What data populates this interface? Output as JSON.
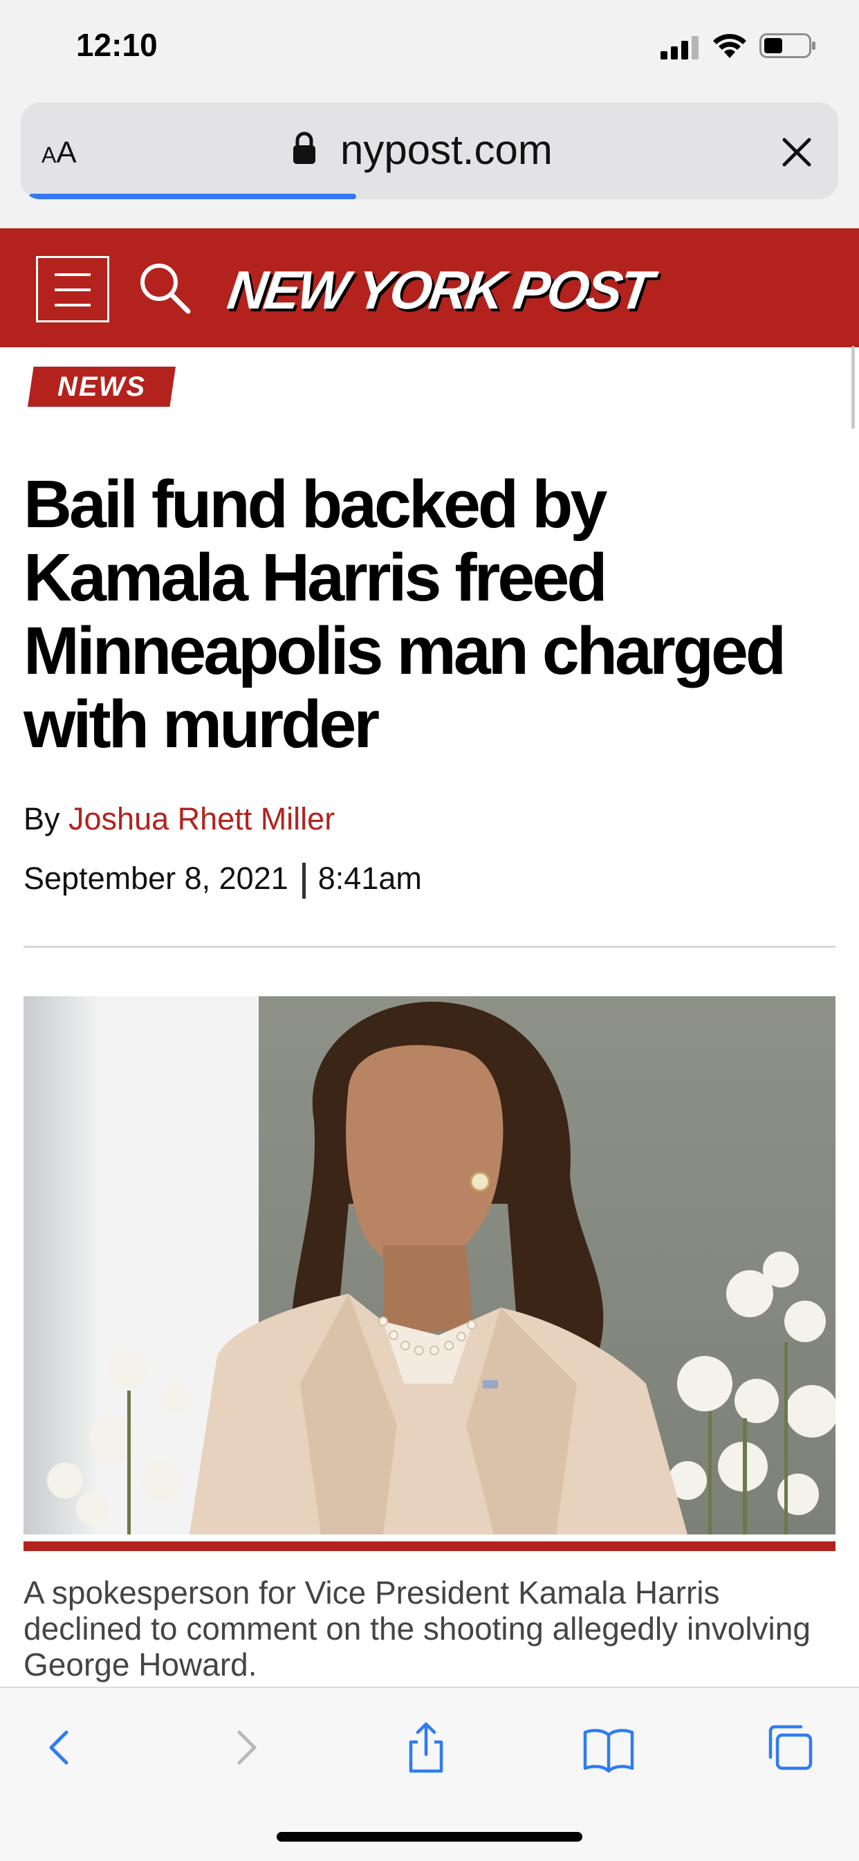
{
  "status_bar": {
    "time": "12:10"
  },
  "browser": {
    "aa_label_small": "A",
    "aa_label_large": "A",
    "url": "nypost.com",
    "load_progress": 0.4
  },
  "site": {
    "logo_text": "NEW YORK POST",
    "brand_color": "#b3221c"
  },
  "article": {
    "section": "NEWS",
    "headline": "Bail fund backed by Kamala Harris freed Minneapolis man charged with murder",
    "byline_prefix": "By",
    "author": "Joshua Rhett Miller",
    "date": "September 8, 2021",
    "time": "8:41am",
    "caption": "A spokesperson for Vice President Kamala Harris declined to comment on the shooting allegedly involving George Howard."
  },
  "toolbar": {
    "icons": [
      "back-icon",
      "forward-icon",
      "share-icon",
      "bookmarks-icon",
      "tabs-icon"
    ]
  }
}
